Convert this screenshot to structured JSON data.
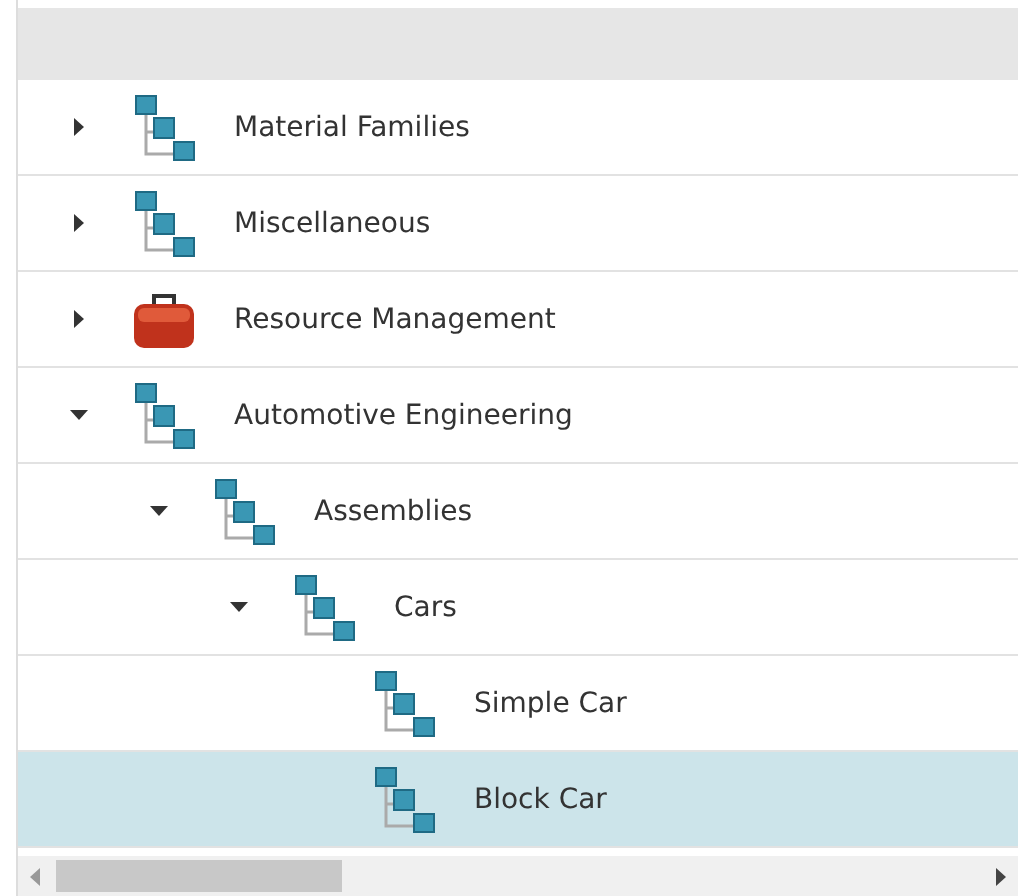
{
  "tree": {
    "items": [
      {
        "label": "Material Families",
        "kind": "hierarchy",
        "expandable": true,
        "expanded": false,
        "selected": false
      },
      {
        "label": "Miscellaneous",
        "kind": "hierarchy",
        "expandable": true,
        "expanded": false,
        "selected": false
      },
      {
        "label": "Resource Management",
        "kind": "toolbox",
        "expandable": true,
        "expanded": false,
        "selected": false
      },
      {
        "label": "Automotive Engineering",
        "kind": "hierarchy",
        "expandable": true,
        "expanded": true,
        "selected": false,
        "children": [
          {
            "label": "Assemblies",
            "kind": "hierarchy",
            "expandable": true,
            "expanded": true,
            "selected": false,
            "children": [
              {
                "label": "Cars",
                "kind": "hierarchy",
                "expandable": true,
                "expanded": true,
                "selected": false,
                "children": [
                  {
                    "label": "Simple Car",
                    "kind": "hierarchy",
                    "expandable": false,
                    "selected": false
                  },
                  {
                    "label": "Block Car",
                    "kind": "hierarchy",
                    "expandable": false,
                    "selected": true
                  }
                ]
              }
            ]
          }
        ]
      }
    ]
  }
}
